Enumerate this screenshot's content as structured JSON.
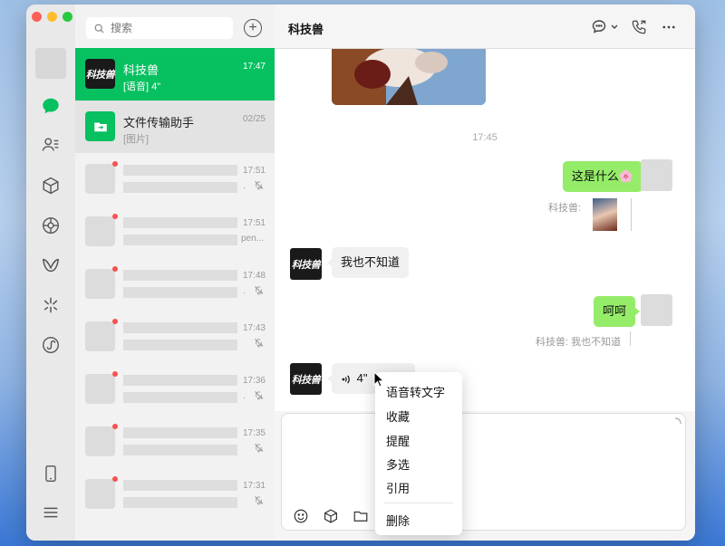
{
  "search": {
    "placeholder": "搜索"
  },
  "header": {
    "title": "科技兽"
  },
  "brand_logo_text": "科技兽",
  "conversations": [
    {
      "name": "科技兽",
      "preview": "[语音] 4\"",
      "time": "17:47"
    },
    {
      "name": "文件传输助手",
      "preview": "[图片]",
      "time": "02/25"
    }
  ],
  "blurred_conversations": [
    {
      "time": "17:51",
      "tail": "."
    },
    {
      "time": "17:51",
      "tail": "pen..."
    },
    {
      "time": "17:48",
      "tail": "."
    },
    {
      "time": "17:43",
      "tail": ""
    },
    {
      "time": "17:36",
      "tail": "."
    },
    {
      "time": "17:35",
      "tail": ""
    },
    {
      "time": "17:31",
      "tail": ""
    }
  ],
  "messages": {
    "timestamp": "17:45",
    "msg1": "这是什么🌸",
    "quote1_prefix": "科技兽:",
    "msg2": "我也不知道",
    "msg3": "呵呵",
    "quote2": "科技兽: 我也不知道",
    "voice_label": "4\""
  },
  "context_menu": {
    "items": [
      "语音转文字",
      "收藏",
      "提醒",
      "多选",
      "引用"
    ],
    "delete": "删除"
  },
  "colors": {
    "accent": "#07c160",
    "bubble_mine": "#95ec69"
  }
}
